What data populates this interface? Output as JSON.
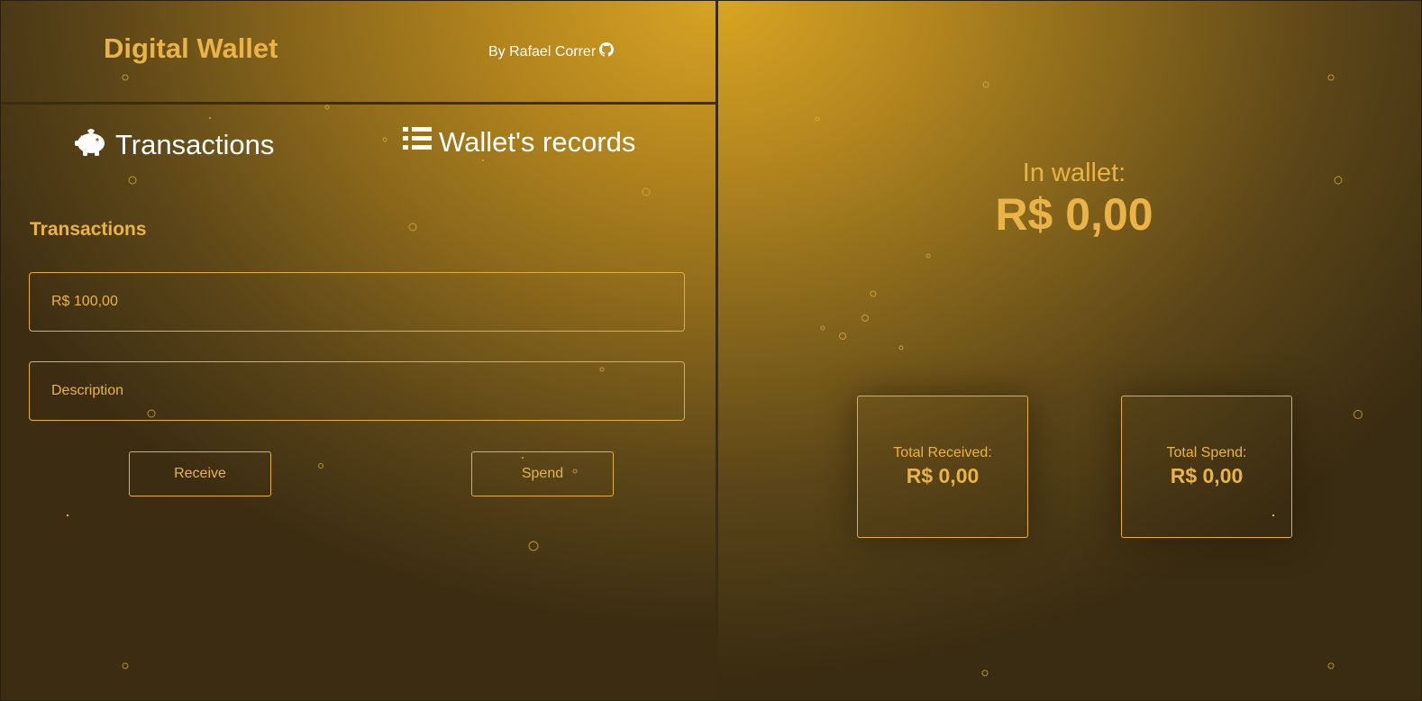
{
  "header": {
    "title": "Digital Wallet",
    "author": "By Rafael Correr",
    "author_icon": "github-icon"
  },
  "nav": {
    "transactions": {
      "label": "Transactions",
      "icon": "piggy-bank-icon"
    },
    "records": {
      "label": "Wallet's records",
      "icon": "list-icon"
    }
  },
  "form": {
    "section_title": "Transactions",
    "amount_value": "R$ 100,00",
    "amount_placeholder": "R$ 100,00",
    "description_placeholder": "Description",
    "receive_label": "Receive",
    "spend_label": "Spend"
  },
  "wallet": {
    "label": "In wallet:",
    "value": "R$ 0,00"
  },
  "totals": {
    "received_label": "Total Received:",
    "received_value": "R$ 0,00",
    "spend_label": "Total Spend:",
    "spend_value": "R$ 0,00"
  },
  "colors": {
    "accent": "#e9b347",
    "gold_highlight": "#d9a522",
    "dark": "#3a2c12"
  }
}
